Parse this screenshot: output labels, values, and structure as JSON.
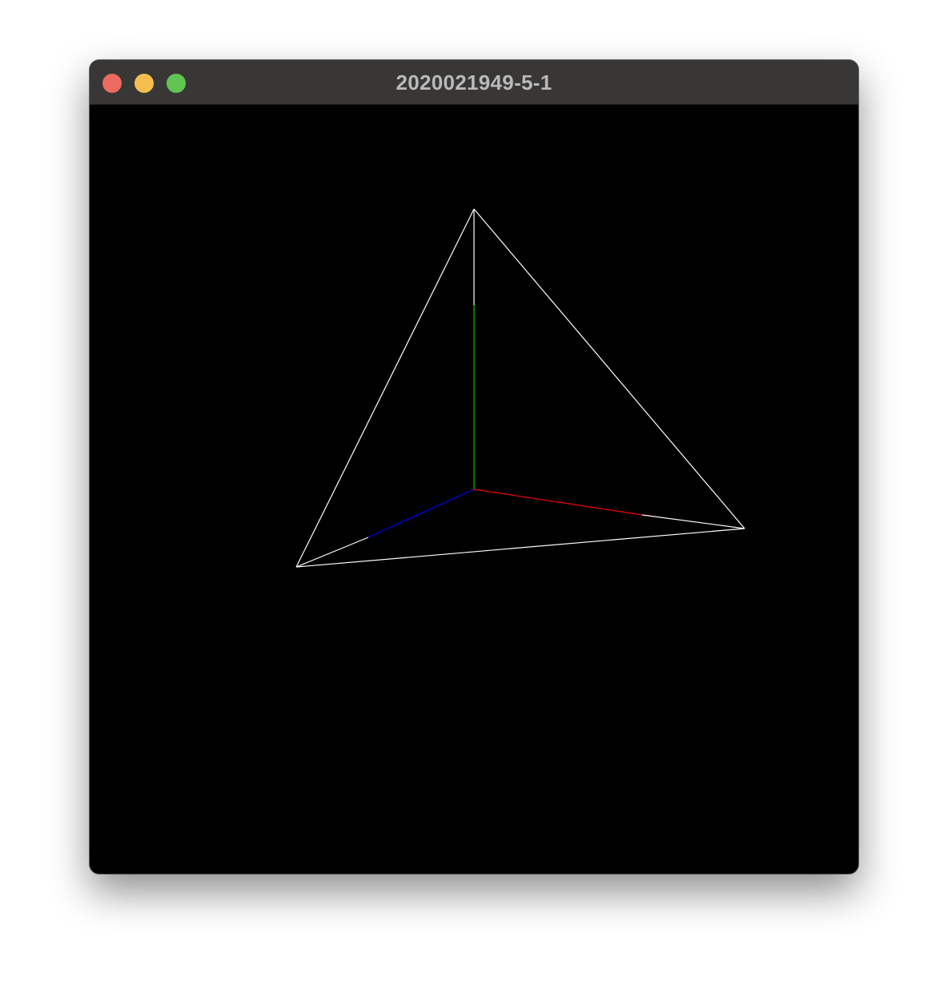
{
  "window": {
    "title": "2020021949-5-1",
    "controls": {
      "close": {
        "name": "close-button",
        "color": "#ed6a5e"
      },
      "minimize": {
        "name": "minimize-button",
        "color": "#f5bf4f"
      },
      "zoom": {
        "name": "zoom-button",
        "color": "#61c554"
      }
    }
  },
  "scene": {
    "background": "#000000",
    "edge_color": "#ffffff",
    "axis_colors": {
      "x": "#ff0000",
      "y": "#00c000",
      "z": "#0000ff"
    }
  }
}
